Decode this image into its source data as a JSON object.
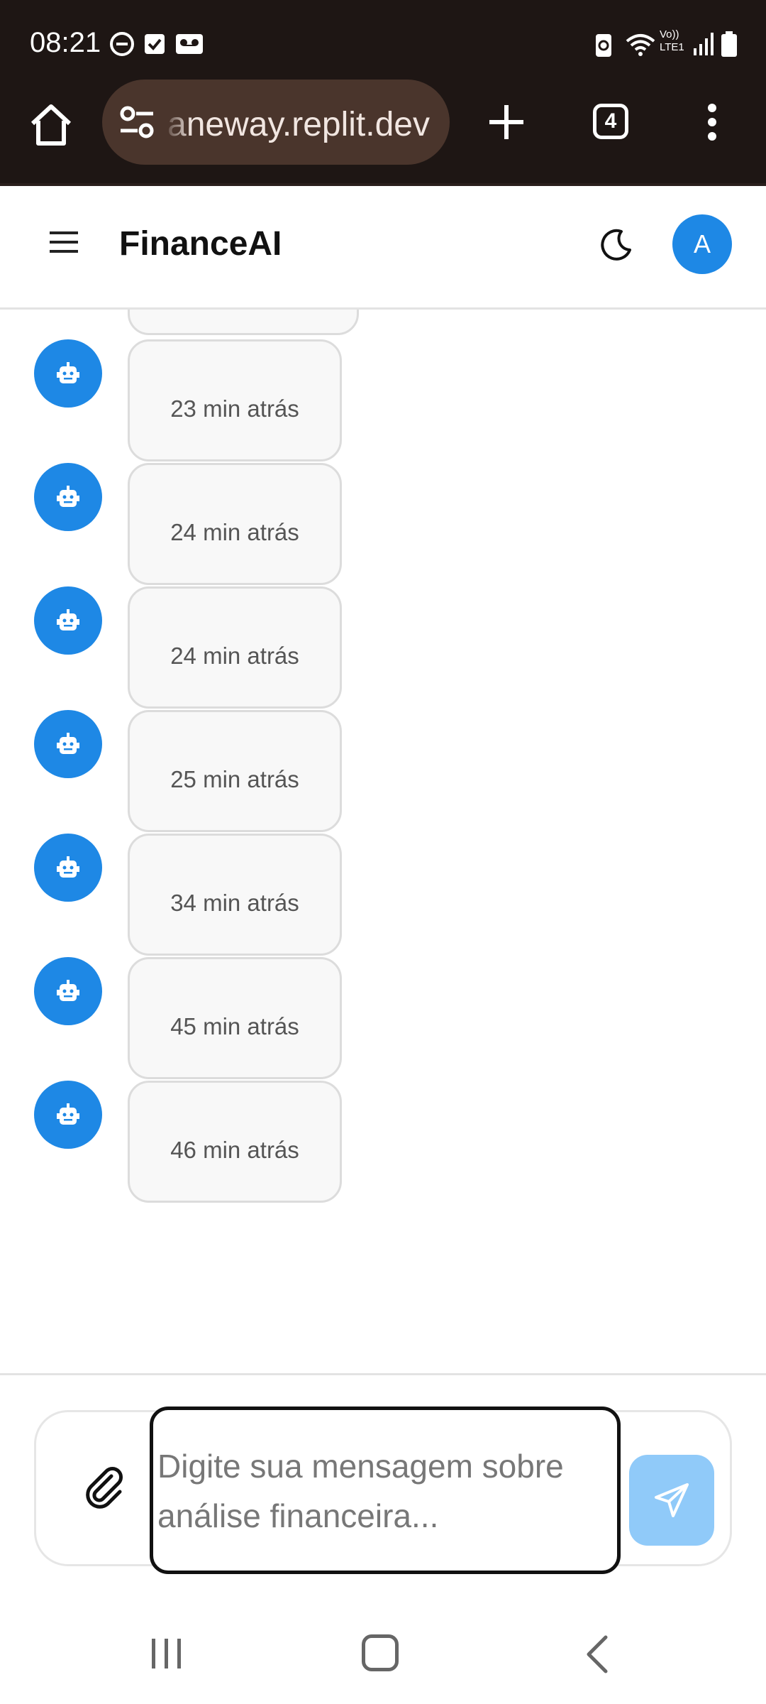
{
  "status_bar": {
    "time": "08:21",
    "icons": [
      "do-not-disturb-icon",
      "checkbox-icon",
      "voicemail-icon",
      "battery-saver-icon",
      "wifi-icon",
      "volte-lte-icon",
      "signal-icon",
      "battery-icon"
    ],
    "network_label_top": "Vo))",
    "network_label_bottom": "LTE1"
  },
  "browser": {
    "url": "aneway.replit.dev",
    "tab_count": "4"
  },
  "app": {
    "title": "FinanceAI",
    "avatar_initial": "A",
    "accent_color": "#1e88e5"
  },
  "messages": [
    {
      "time": "23 min atrás"
    },
    {
      "time": "24 min atrás"
    },
    {
      "time": "24 min atrás"
    },
    {
      "time": "25 min atrás"
    },
    {
      "time": "34 min atrás"
    },
    {
      "time": "45 min atrás"
    },
    {
      "time": "46 min atrás"
    }
  ],
  "composer": {
    "placeholder": "Digite sua mensagem sobre análise financeira...",
    "send_color": "#90caf9"
  }
}
